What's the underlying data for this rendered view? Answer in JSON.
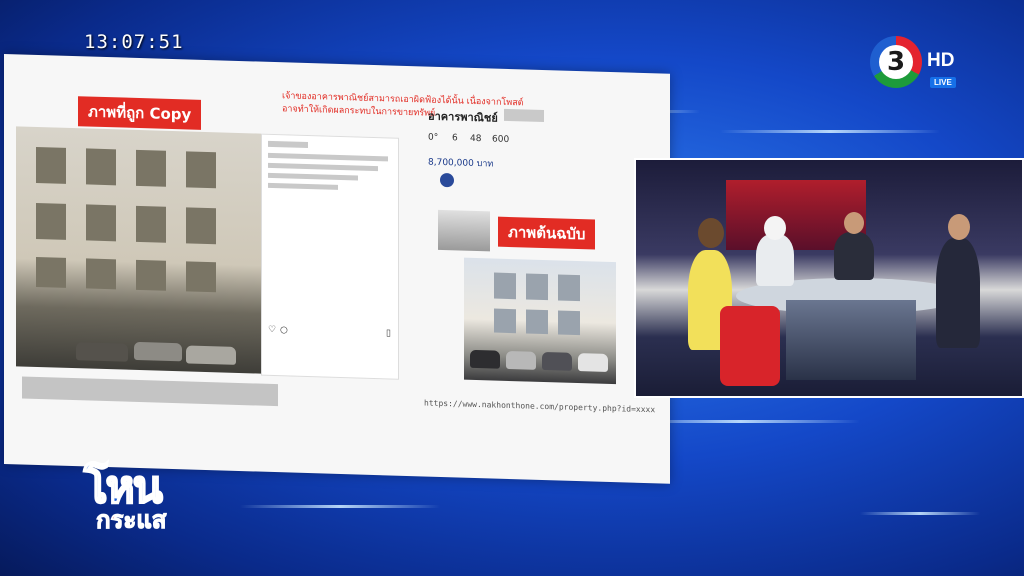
{
  "broadcast": {
    "clock": "13:07:51",
    "channel_number": "3",
    "channel_hd": "HD",
    "live_label": "LIVE"
  },
  "board": {
    "copied_label": "ภาพที่ถูก Copy",
    "original_label": "ภาพต้นฉบับ",
    "note_line1": "เจ้าของอาคารพาณิชย์สามารถเอาผิดฟ้องได้นั้น เนื่องจากโพสต์",
    "note_line2": "อาจทำให้เกิดผลกระทบในการขายทรัพย์",
    "property_title": "อาคารพาณิชย์",
    "stats": [
      {
        "value": "0°",
        "label": ""
      },
      {
        "value": "6",
        "label": ""
      },
      {
        "value": "48",
        "label": ""
      },
      {
        "value": "600",
        "label": ""
      }
    ],
    "price": "8,700,000 บาท",
    "url": "https://www.nakhonthone.com/property.php?id=xxxx"
  },
  "show": {
    "title_top": "โหน",
    "title_bottom": "กระแส"
  },
  "colors": {
    "accent_red": "#e22c24",
    "bg_blue": "#1448c8"
  }
}
